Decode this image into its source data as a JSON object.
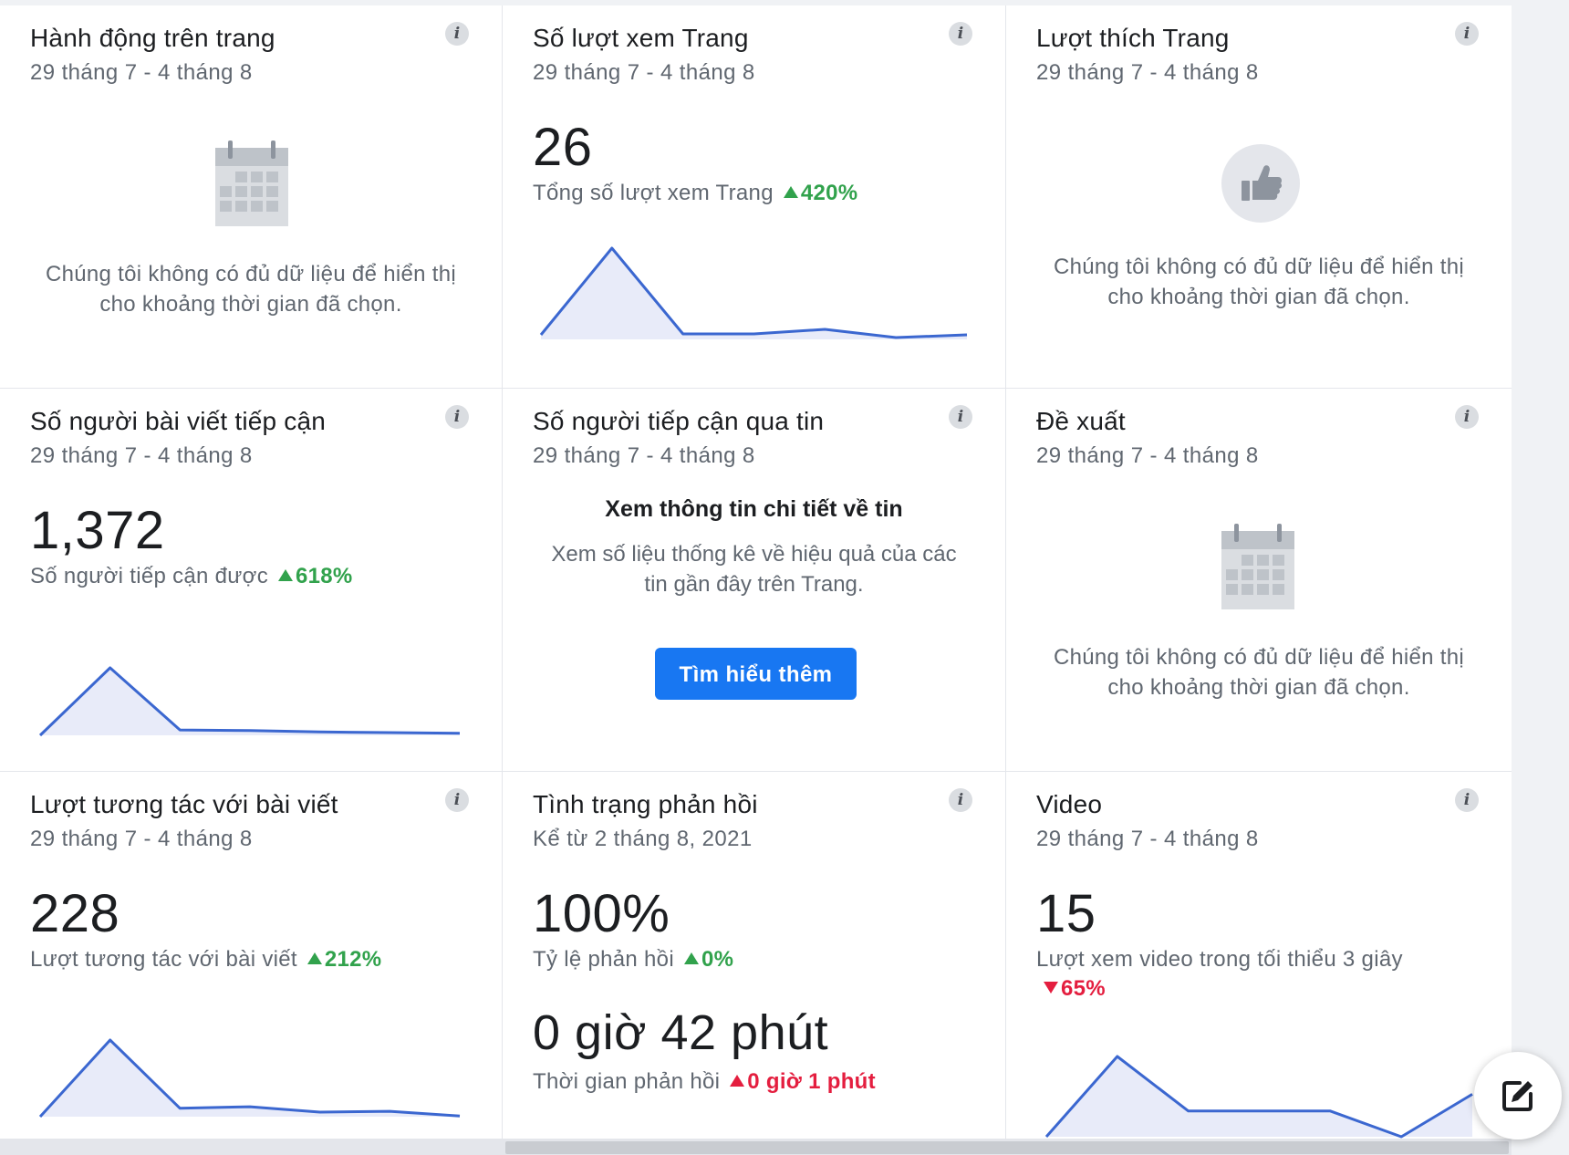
{
  "colors": {
    "positive": "#31a24c",
    "negative": "#e41e3f",
    "spark_line": "#3b67d0",
    "spark_fill": "#e8ebf9",
    "button": "#1877f2"
  },
  "info_glyph": "i",
  "cards": {
    "page_actions": {
      "title": "Hành động trên trang",
      "date": "29 tháng 7 - 4 tháng 8",
      "icon": "calendar-icon",
      "empty_msg": "Chúng tôi không có đủ dữ liệu để hiển thị cho khoảng thời gian đã chọn."
    },
    "page_views": {
      "title": "Số lượt xem Trang",
      "date": "29 tháng 7 - 4 tháng 8",
      "value": "26",
      "label": "Tổng số lượt xem Trang",
      "delta": "420%",
      "delta_dir": "up",
      "spark": [
        0.05,
        1.0,
        0.06,
        0.06,
        0.11,
        0.02,
        0.05
      ]
    },
    "page_likes": {
      "title": "Lượt thích Trang",
      "date": "29 tháng 7 - 4 tháng 8",
      "icon": "thumbs-up-icon",
      "empty_msg": "Chúng tôi không có đủ dữ liệu để hiển thị cho khoảng thời gian đã chọn."
    },
    "post_reach": {
      "title": "Số người bài viết tiếp cận",
      "date": "29 tháng 7 - 4 tháng 8",
      "value": "1,372",
      "label": "Số người tiếp cận được",
      "delta": "618%",
      "delta_dir": "up",
      "spark": [
        0.0,
        1.0,
        0.08,
        0.07,
        0.05,
        0.04,
        0.03
      ]
    },
    "story_reach": {
      "title": "Số người tiếp cận qua tin",
      "date": "29 tháng 7 - 4 tháng 8",
      "heading": "Xem thông tin chi tiết về tin",
      "desc": "Xem số liệu thống kê về hiệu quả của các tin gần đây trên Trang.",
      "button": "Tìm hiểu thêm"
    },
    "recommendations": {
      "title": "Đề xuất",
      "date": "29 tháng 7 - 4 tháng 8",
      "icon": "calendar-icon",
      "empty_msg": "Chúng tôi không có đủ dữ liệu để hiển thị cho khoảng thời gian đã chọn."
    },
    "post_engagement": {
      "title": "Lượt tương tác với bài viết",
      "date": "29 tháng 7 - 4 tháng 8",
      "value": "228",
      "label": "Lượt tương tác với bài viết",
      "delta": "212%",
      "delta_dir": "up",
      "spark": [
        0.0,
        1.0,
        0.11,
        0.13,
        0.06,
        0.07,
        0.01
      ]
    },
    "responsiveness": {
      "title": "Tình trạng phản hồi",
      "date": "Kể từ 2 tháng 8, 2021",
      "value": "100%",
      "label": "Tỷ lệ phản hồi",
      "delta": "0%",
      "delta_dir": "up",
      "time_value": "0 giờ 42 phút",
      "time_label": "Thời gian phản hồi",
      "time_delta": "0 giờ 1 phút"
    },
    "video": {
      "title": "Video",
      "date": "29 tháng 7 - 4 tháng 8",
      "value": "15",
      "label": "Lượt xem video trong tối thiểu 3 giây",
      "delta": "65%",
      "delta_dir": "down",
      "spark": [
        0.0,
        1.0,
        0.32,
        0.32,
        0.32,
        0.0,
        0.53
      ]
    }
  },
  "fab": {
    "icon": "compose-icon"
  }
}
